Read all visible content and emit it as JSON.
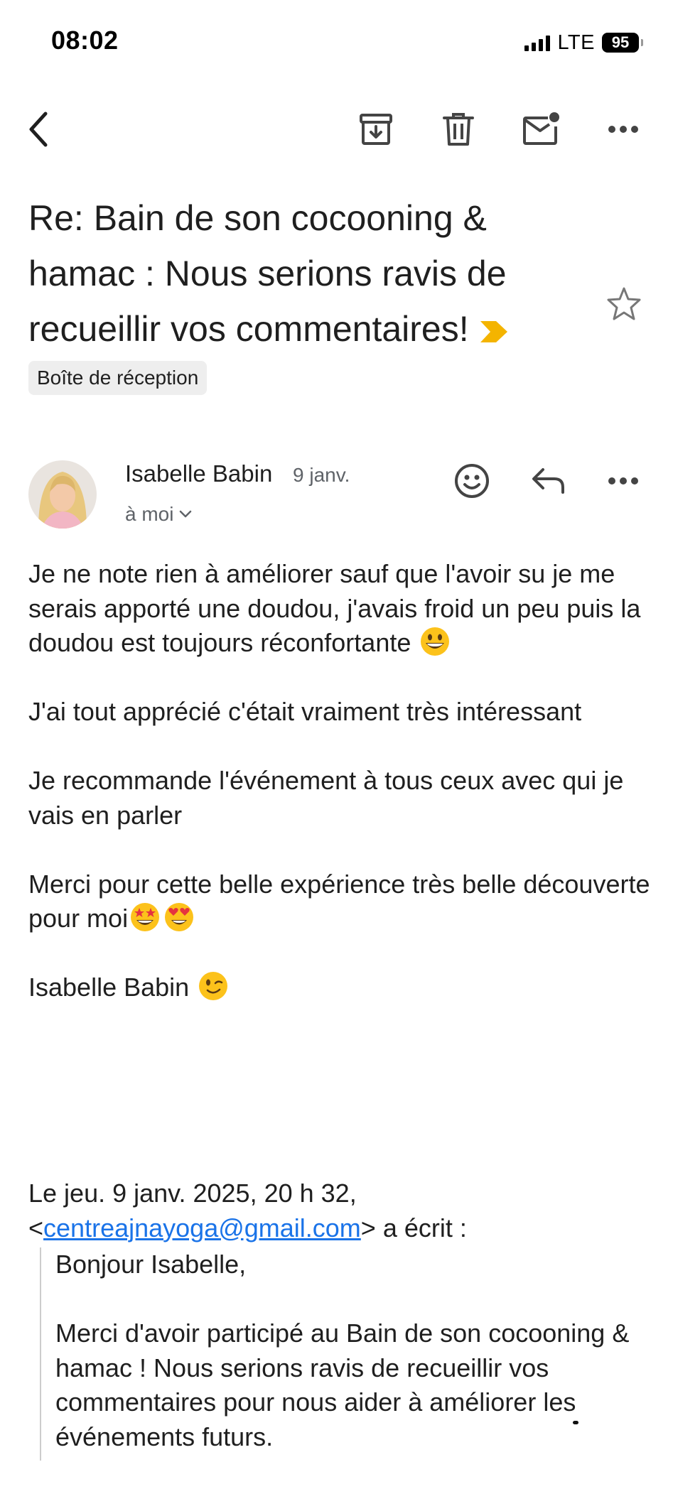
{
  "status_bar": {
    "time": "08:02",
    "network": "LTE",
    "battery": "95"
  },
  "toolbar": {
    "back_icon": "chevron-left-icon",
    "archive_icon": "archive-icon",
    "delete_icon": "trash-icon",
    "mark_unread_icon": "mail-unread-icon",
    "more_icon": "more-horizontal-icon"
  },
  "email": {
    "subject": "Re: Bain de son cocooning & hamac : Nous serions ravis de recueillir vos commentaires!",
    "label": "Boîte de réception",
    "importance_color": "#f4b400",
    "sender": {
      "name": "Isabelle Babin",
      "date": "9 janv.",
      "to": "à moi"
    },
    "body": {
      "p1": "Je ne note rien à améliorer sauf que l'avoir su je me serais apporté une doudou,  j'avais froid un peu puis la doudou est toujours réconfortante",
      "p2": "J'ai tout apprécié c'était vraiment très intéressant",
      "p3": "Je recommande l'événement à tous ceux avec qui je vais en parler",
      "p4": "Merci pour cette belle expérience très belle découverte pour moi",
      "p5": "Isabelle Babin"
    },
    "quote_header": {
      "line1": "Le jeu. 9 janv. 2025, 20 h 32,",
      "open": "<",
      "email": "centreajnayoga@gmail.com",
      "close": "> a écrit :"
    },
    "quoted": {
      "greeting": "Bonjour Isabelle,",
      "text_before": "Merci d'avoir participé au Bain de son cocooning & hamac ! Nous serions ravis de recueillir vos commentaires pour nous aider à améliorer les",
      "text_scribbled": " événements futurs",
      "text_after": "."
    }
  }
}
